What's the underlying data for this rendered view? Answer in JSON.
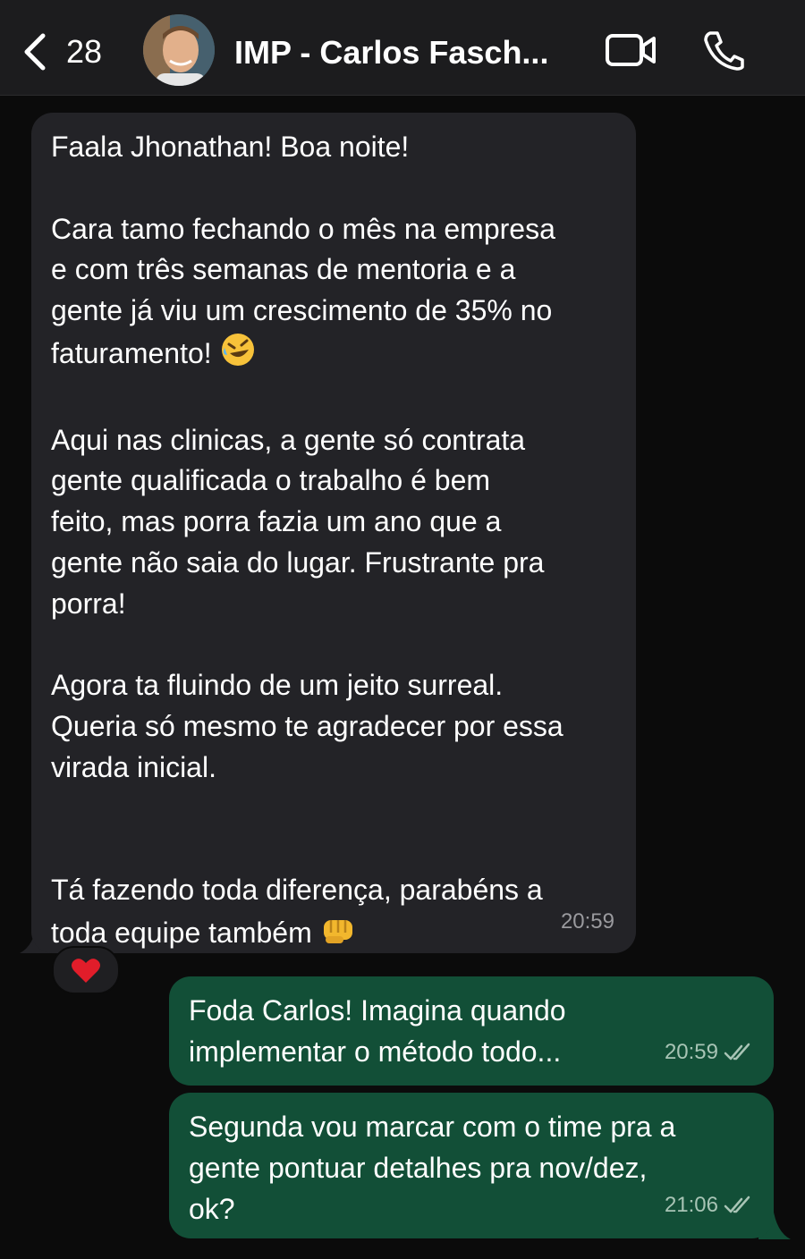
{
  "header": {
    "back_count": "28",
    "title": "IMP - Carlos Fasch..."
  },
  "messages": {
    "incoming": {
      "p1": "Faala Jhonathan! Boa noite!",
      "p2": "Cara tamo fechando o mês na empresa\ne com três semanas de mentoria e a\ngente já viu um crescimento de 35% no\nfaturamento! ",
      "p2_emoji": "rolling-on-floor-laughing",
      "p3": "Aqui nas clinicas, a gente só contrata\ngente qualificada o trabalho é bem\nfeito, mas porra fazia um ano que a\ngente não saia do lugar. Frustrante pra\nporra!",
      "p4": "Agora ta fluindo de um jeito surreal.\nQueria só mesmo te agradecer por essa\nvirada inicial.",
      "p5": "Tá fazendo toda diferença, parabéns a\ntoda equipe também ",
      "p5_emoji": "oncoming-fist",
      "time": "20:59",
      "reaction": "red-heart"
    },
    "outgoing": [
      {
        "text": "Foda Carlos! Imagina quando\nimplementar o método todo...",
        "time": "20:59"
      },
      {
        "text": "Segunda vou marcar com o time pra a\ngente pontuar detalhes pra nov/dez,\nok?",
        "time": "21:06"
      }
    ]
  },
  "colors": {
    "header_bg": "#1c1c1e",
    "incoming_bubble": "#232327",
    "outgoing_bubble": "#124f37",
    "background": "#0b0b0b"
  }
}
